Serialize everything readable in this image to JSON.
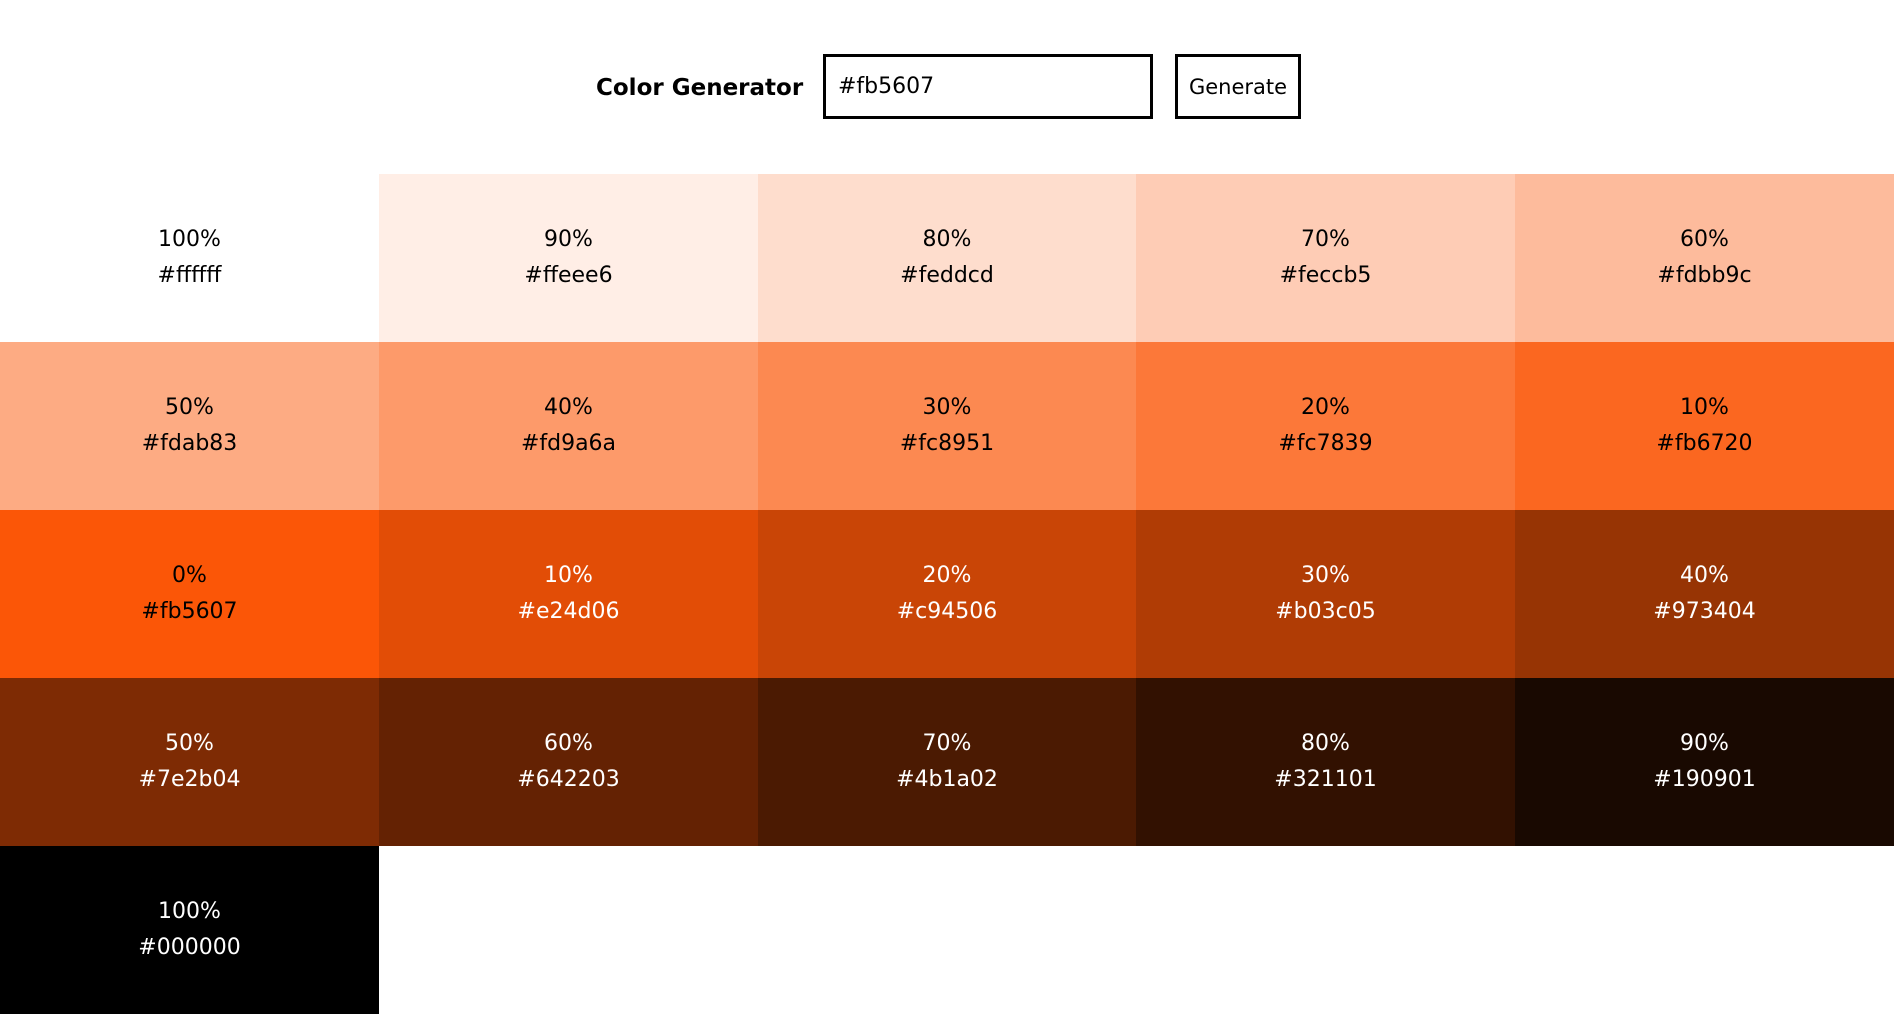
{
  "header": {
    "title": "Color Generator",
    "input_value": "#fb5607",
    "button_label": "Generate"
  },
  "swatches": [
    {
      "percent": "100%",
      "hex": "#ffffff",
      "color": "#ffffff",
      "text": "light"
    },
    {
      "percent": "90%",
      "hex": "#ffeee6",
      "color": "#ffeee6",
      "text": "light"
    },
    {
      "percent": "80%",
      "hex": "#feddcd",
      "color": "#feddcd",
      "text": "light"
    },
    {
      "percent": "70%",
      "hex": "#feccb5",
      "color": "#feccb5",
      "text": "light"
    },
    {
      "percent": "60%",
      "hex": "#fdbb9c",
      "color": "#fdbb9c",
      "text": "light"
    },
    {
      "percent": "50%",
      "hex": "#fdab83",
      "color": "#fdab83",
      "text": "light"
    },
    {
      "percent": "40%",
      "hex": "#fd9a6a",
      "color": "#fd9a6a",
      "text": "light"
    },
    {
      "percent": "30%",
      "hex": "#fc8951",
      "color": "#fc8951",
      "text": "light"
    },
    {
      "percent": "20%",
      "hex": "#fc7839",
      "color": "#fc7839",
      "text": "light"
    },
    {
      "percent": "10%",
      "hex": "#fb6720",
      "color": "#fb6720",
      "text": "light"
    },
    {
      "percent": "0%",
      "hex": "#fb5607",
      "color": "#fb5607",
      "text": "light"
    },
    {
      "percent": "10%",
      "hex": "#e24d06",
      "color": "#e24d06",
      "text": "dark"
    },
    {
      "percent": "20%",
      "hex": "#c94506",
      "color": "#c94506",
      "text": "dark"
    },
    {
      "percent": "30%",
      "hex": "#b03c05",
      "color": "#b03c05",
      "text": "dark"
    },
    {
      "percent": "40%",
      "hex": "#973404",
      "color": "#973404",
      "text": "dark"
    },
    {
      "percent": "50%",
      "hex": "#7e2b04",
      "color": "#7e2b04",
      "text": "dark"
    },
    {
      "percent": "60%",
      "hex": "#642203",
      "color": "#642203",
      "text": "dark"
    },
    {
      "percent": "70%",
      "hex": "#4b1a02",
      "color": "#4b1a02",
      "text": "dark"
    },
    {
      "percent": "80%",
      "hex": "#321101",
      "color": "#321101",
      "text": "dark"
    },
    {
      "percent": "90%",
      "hex": "#190901",
      "color": "#190901",
      "text": "dark"
    },
    {
      "percent": "100%",
      "hex": "#000000",
      "color": "#000000",
      "text": "dark"
    }
  ]
}
